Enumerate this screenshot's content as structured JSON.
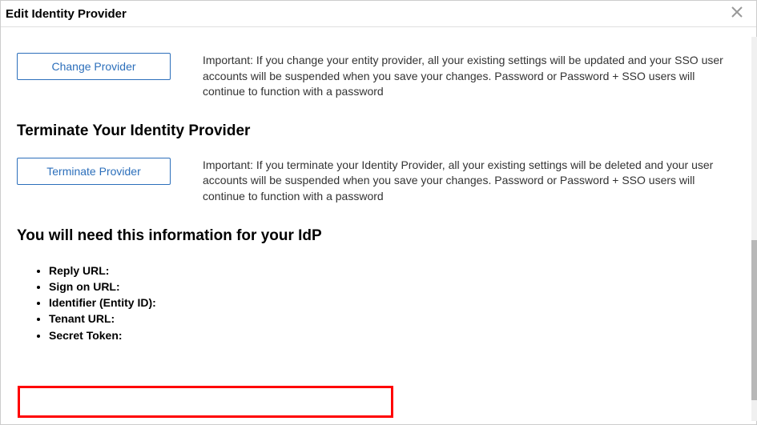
{
  "header": {
    "title": "Edit Identity Provider"
  },
  "changeProvider": {
    "button": "Change Provider",
    "text": "Important: If you change your entity provider, all your existing settings will be updated and your SSO user accounts will be suspended when you save your changes. Password or Password + SSO users will continue to function with a password"
  },
  "terminate": {
    "heading": "Terminate Your Identity Provider",
    "button": "Terminate Provider",
    "text": "Important: If you terminate your Identity Provider, all your existing settings will be deleted and your user accounts will be suspended when you save your changes. Password or Password + SSO users will continue to function with a password"
  },
  "idpInfo": {
    "heading": "You will need this information for your IdP",
    "items": [
      "Reply URL:",
      "Sign on URL:",
      "Identifier (Entity ID):",
      "Tenant URL:",
      "Secret Token:"
    ]
  }
}
